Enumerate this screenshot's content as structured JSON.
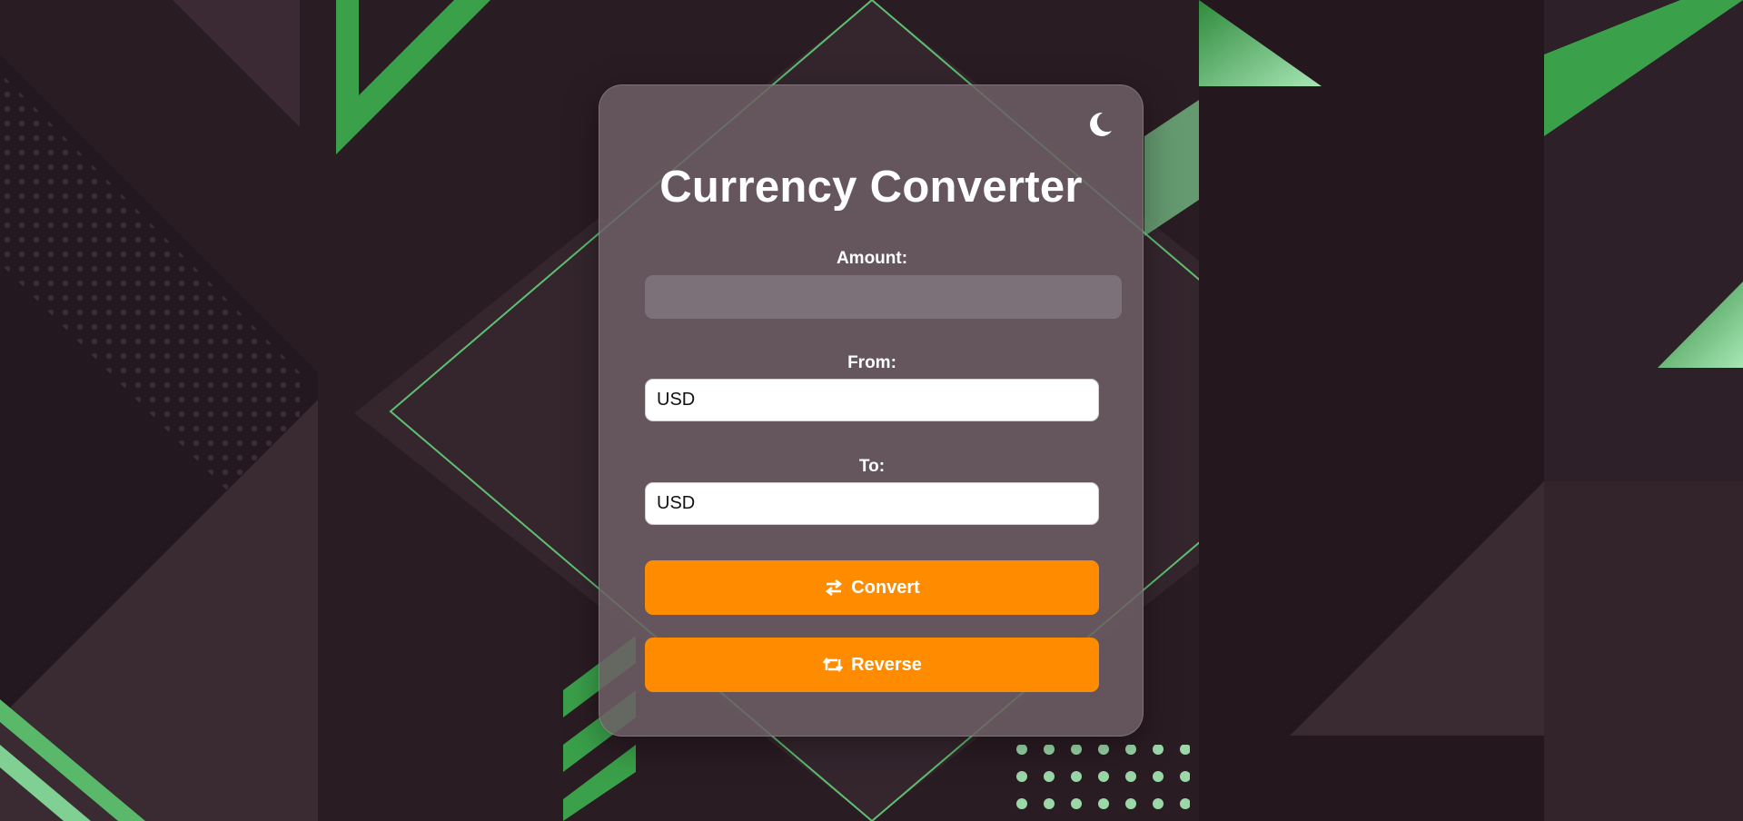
{
  "app": {
    "title": "Currency Converter"
  },
  "theme_toggle": {
    "icon": "moon-icon"
  },
  "amount": {
    "label": "Amount:",
    "value": "",
    "placeholder": ""
  },
  "from": {
    "label": "From:",
    "selected": "USD"
  },
  "to": {
    "label": "To:",
    "selected": "USD"
  },
  "buttons": {
    "convert_label": "Convert",
    "convert_icon": "exchange-arrows-icon",
    "reverse_label": "Reverse",
    "reverse_icon": "retweet-icon"
  },
  "colors": {
    "accent": "#ff8c00",
    "background": "#2a1c23",
    "card": "#6c5e64",
    "decor_green": "#3aa04a"
  }
}
